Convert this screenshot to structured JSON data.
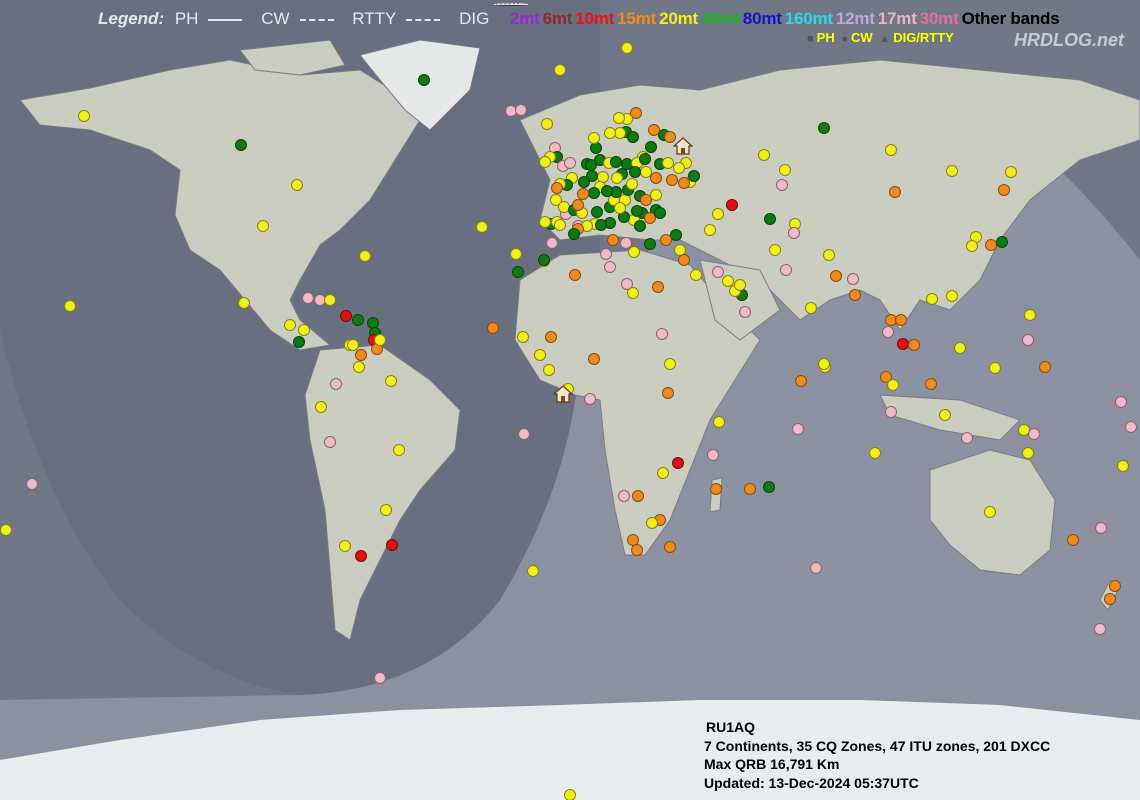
{
  "legend": {
    "title": "Legend:",
    "modes": [
      "PH",
      "CW",
      "RTTY",
      "DIG"
    ],
    "bands": [
      {
        "label": "2mt",
        "color": "#9a24d6"
      },
      {
        "label": "6mt",
        "color": "#8b2b2b"
      },
      {
        "label": "10mt",
        "color": "#ee1111"
      },
      {
        "label": "15mt",
        "color": "#f08a1c"
      },
      {
        "label": "20mt",
        "color": "#f2ee1a"
      },
      {
        "label": "40mt",
        "color": "#18b818"
      },
      {
        "label": "80mt",
        "color": "#1414c8"
      },
      {
        "label": "160mt",
        "color": "#2fd6e6"
      },
      {
        "label": "12mt",
        "color": "#c6a3d6"
      },
      {
        "label": "17mt",
        "color": "#e8b4be"
      },
      {
        "label": "30mt",
        "color": "#e46ea0"
      },
      {
        "label": "Other bands",
        "color": "#000000"
      }
    ],
    "markers": [
      "PH",
      "CW",
      "DIG/RTTY"
    ]
  },
  "site": "HRDLOG.net",
  "stats": {
    "callsign": "RU1AQ",
    "summary": "7 Continents, 35 CQ Zones, 47 ITU zones, 201 DXCC",
    "max_qrb": "Max QRB 16,791 Km",
    "updated": "Updated: 13-Dec-2024 05:37UTC"
  },
  "colors": {
    "ocean": "#707888",
    "land": "#c9ccbf",
    "daylight": "#ffffff",
    "yellow": "#f2ee1a",
    "green": "#0f7a12",
    "orange": "#f08a1c",
    "pink": "#f2b8c6",
    "red": "#e01010",
    "lilac": "#d8a8d8"
  }
}
